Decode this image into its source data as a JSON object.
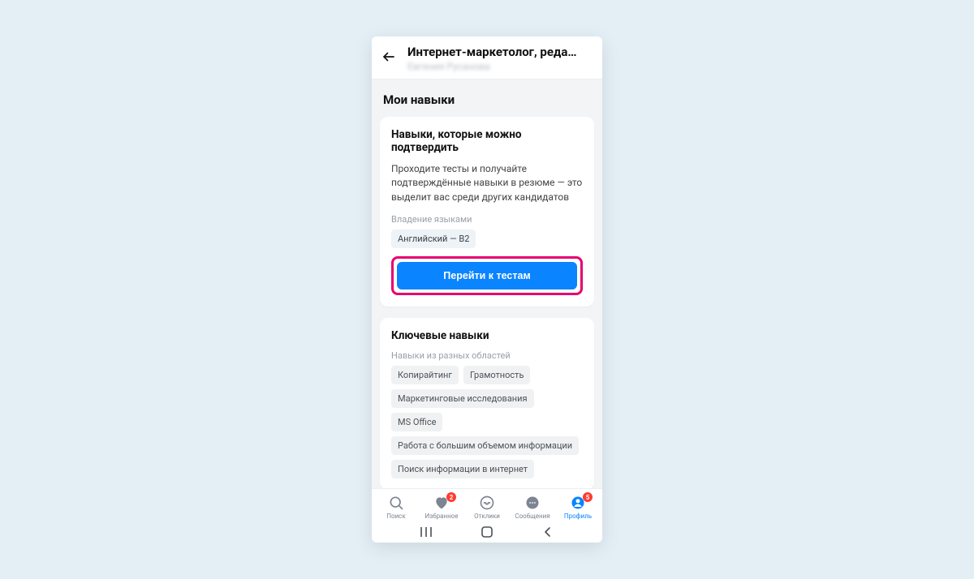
{
  "header": {
    "title": "Интернет-маркетолог, реда…",
    "subtitle": "Евгения Русанова"
  },
  "section_title": "Мои навыки",
  "verify_card": {
    "title": "Навыки, которые можно подтвердить",
    "desc": "Проходите тесты и получайте подтверждённые навыки в резюме — это выделит вас среди других кандидатов",
    "label": "Владение языками",
    "chip": "Английский — B2",
    "button": "Перейти к тестам"
  },
  "key_card": {
    "title": "Ключевые навыки",
    "label": "Навыки из разных областей",
    "chips": [
      "Копирайтинг",
      "Грамотность",
      "Маркетинговые исследования",
      "MS Office",
      "Работа с большим объемом информации",
      "Поиск информации в интернет"
    ]
  },
  "nav": {
    "search": "Поиск",
    "favorites": {
      "label": "Избранное",
      "badge": "2"
    },
    "responses": "Отклики",
    "messages": "Сообщения",
    "profile": {
      "label": "Профиль",
      "badge": "5"
    }
  }
}
